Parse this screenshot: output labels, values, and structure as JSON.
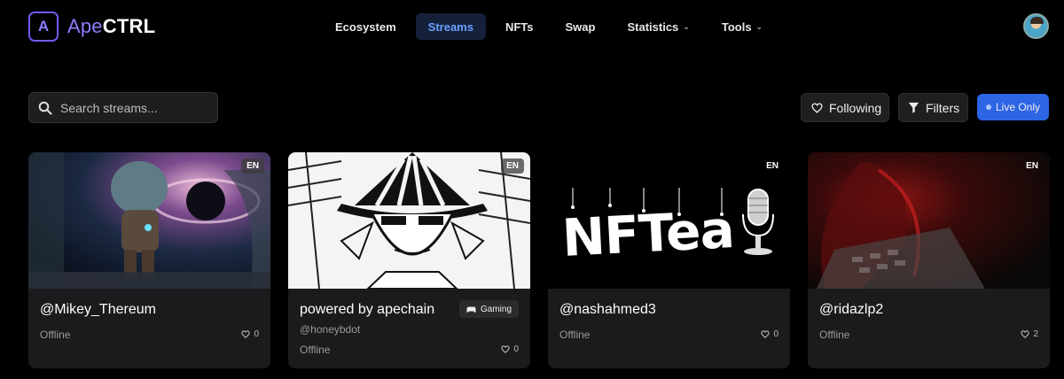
{
  "header": {
    "logo_letter": "A",
    "brand_part1": "Ape",
    "brand_part2": "CTRL",
    "nav": [
      {
        "label": "Ecosystem",
        "active": false,
        "dropdown": false
      },
      {
        "label": "Streams",
        "active": true,
        "dropdown": false
      },
      {
        "label": "NFTs",
        "active": false,
        "dropdown": false
      },
      {
        "label": "Swap",
        "active": false,
        "dropdown": false
      },
      {
        "label": "Statistics",
        "active": false,
        "dropdown": true
      },
      {
        "label": "Tools",
        "active": false,
        "dropdown": true
      }
    ]
  },
  "toolbar": {
    "search_placeholder": "Search streams...",
    "following_label": "Following",
    "filters_label": "Filters",
    "live_only_label": "Live Only"
  },
  "streams": [
    {
      "title": "@Mikey_Thereum",
      "subtitle": "",
      "tag": "",
      "status": "Offline",
      "likes": "0",
      "lang": "EN"
    },
    {
      "title": "powered by apechain",
      "subtitle": "@honeybdot",
      "tag": "Gaming",
      "status": "Offline",
      "likes": "0",
      "lang": "EN"
    },
    {
      "title": "@nashahmed3",
      "subtitle": "",
      "tag": "",
      "status": "Offline",
      "likes": "0",
      "lang": "EN",
      "thumb_text": "NFTea"
    },
    {
      "title": "@ridazlp2",
      "subtitle": "",
      "tag": "",
      "status": "Offline",
      "likes": "2",
      "lang": "EN"
    }
  ],
  "colors": {
    "accent": "#2d65e5",
    "brand": "#8b7cff",
    "active_nav_bg": "#15213a",
    "card_bg": "#1b1b1d"
  }
}
